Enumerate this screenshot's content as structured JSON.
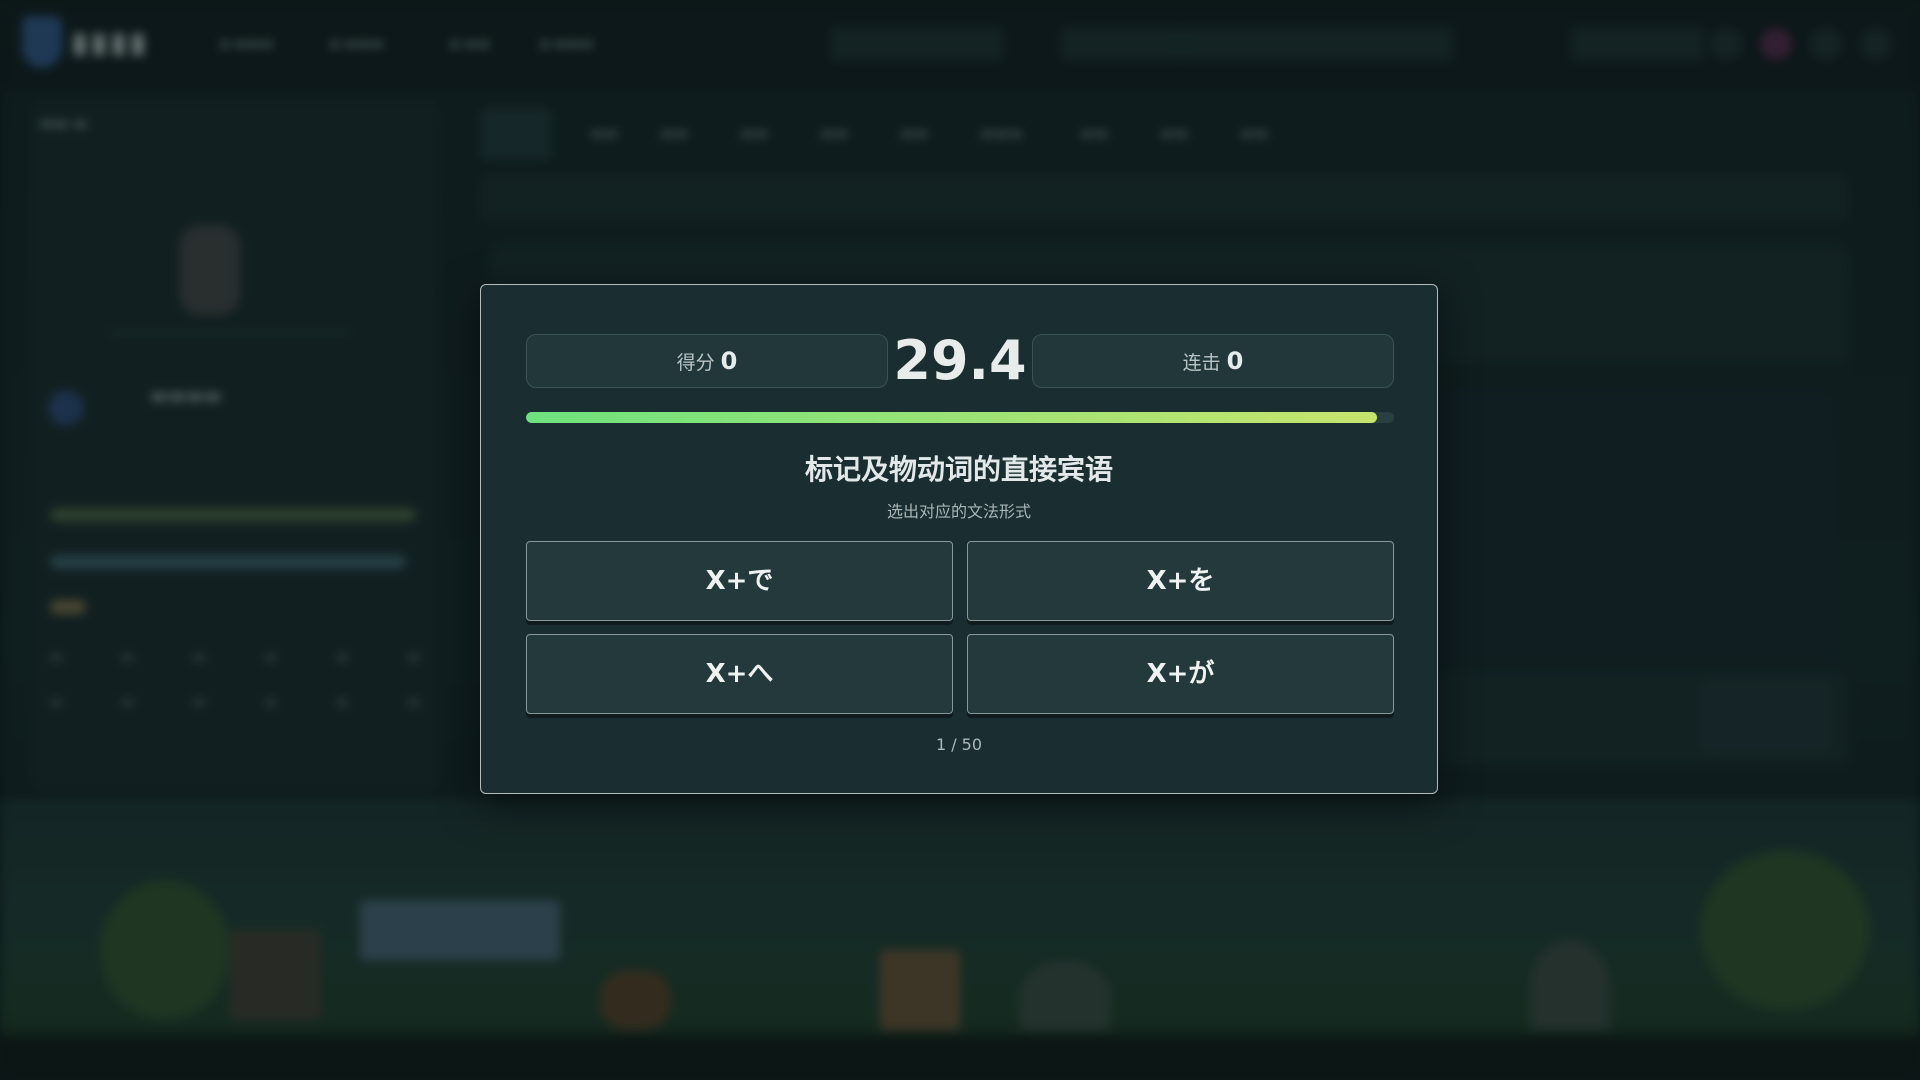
{
  "quiz": {
    "score_label": "得分",
    "score_value": "0",
    "timer": "29.4",
    "combo_label": "连击",
    "combo_value": "0",
    "time_remaining_fraction": 0.98,
    "question": "标记及物动词的直接宾语",
    "hint": "选出对应的文法形式",
    "options": [
      "X+で",
      "X+を",
      "X+へ",
      "X+が"
    ],
    "progress_text": "1 / 50"
  },
  "colors": {
    "progress_start": "#6ee27e",
    "progress_end": "#c7e46d",
    "modal_bg": "#1a2d30",
    "option_bg": "#24393c"
  }
}
